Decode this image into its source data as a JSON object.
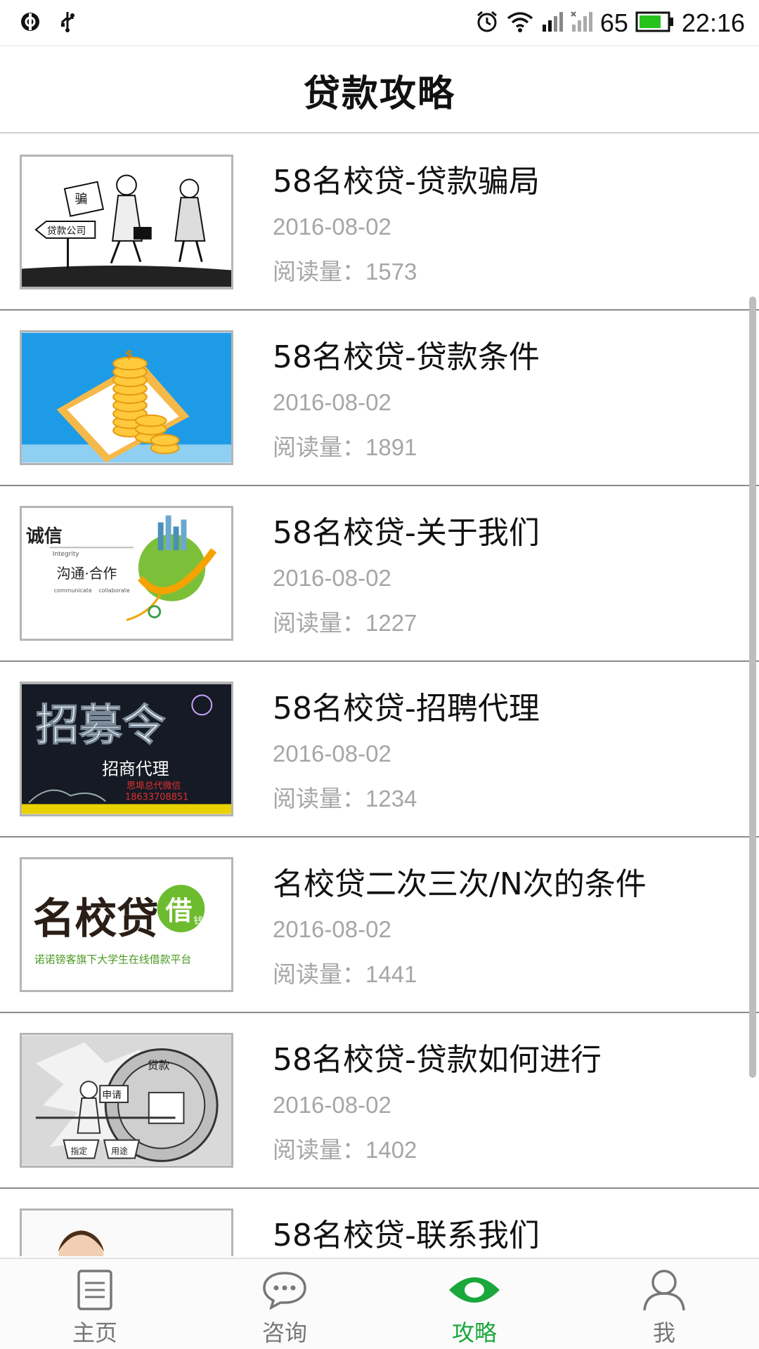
{
  "status_bar": {
    "battery_percent": "65",
    "time": "22:16",
    "icons": [
      "notification-icon",
      "usb-icon",
      "alarm-icon",
      "wifi-icon",
      "signal-icon",
      "signal-no-service-icon",
      "battery-icon"
    ]
  },
  "header": {
    "title": "贷款攻略"
  },
  "articles": [
    {
      "title": "58名校贷-贷款骗局",
      "date": "2016-08-02",
      "reads_label": "阅读量：",
      "reads": "1573",
      "thumb_text": [
        "骗",
        "贷款公司"
      ]
    },
    {
      "title": "58名校贷-贷款条件",
      "date": "2016-08-02",
      "reads_label": "阅读量：",
      "reads": "1891",
      "thumb_text": [
        "$"
      ]
    },
    {
      "title": "58名校贷-关于我们",
      "date": "2016-08-02",
      "reads_label": "阅读量：",
      "reads": "1227",
      "thumb_text": [
        "诚信",
        "Integrity",
        "沟通·合作",
        "communicate",
        "collaborate"
      ]
    },
    {
      "title": "58名校贷-招聘代理",
      "date": "2016-08-02",
      "reads_label": "阅读量：",
      "reads": "1234",
      "thumb_text": [
        "招募令",
        "招商代理",
        "思埠总代微信",
        "18633708851"
      ]
    },
    {
      "title": "名校贷二次三次/N次的条件",
      "date": "2016-08-02",
      "reads_label": "阅读量：",
      "reads": "1441",
      "thumb_text": [
        "名校贷",
        "借",
        "钱",
        "诺诺镑客旗下大学生在线借款平台"
      ]
    },
    {
      "title": "58名校贷-贷款如何进行",
      "date": "2016-08-02",
      "reads_label": "阅读量：",
      "reads": "1402",
      "thumb_text": [
        "贷款",
        "申请",
        "指定",
        "用途"
      ]
    },
    {
      "title": "58名校贷-联系我们",
      "date": "",
      "reads_label": "",
      "reads": "",
      "thumb_text": []
    }
  ],
  "tabs": [
    {
      "label": "主页",
      "icon": "document-icon",
      "active": false
    },
    {
      "label": "咨询",
      "icon": "chat-bubble-icon",
      "active": false
    },
    {
      "label": "攻略",
      "icon": "eye-icon",
      "active": true
    },
    {
      "label": "我",
      "icon": "user-icon",
      "active": false
    }
  ],
  "colors": {
    "accent": "#1aa83b",
    "text": "#111111",
    "muted": "#a6a6a6",
    "battery": "#27c21e"
  }
}
